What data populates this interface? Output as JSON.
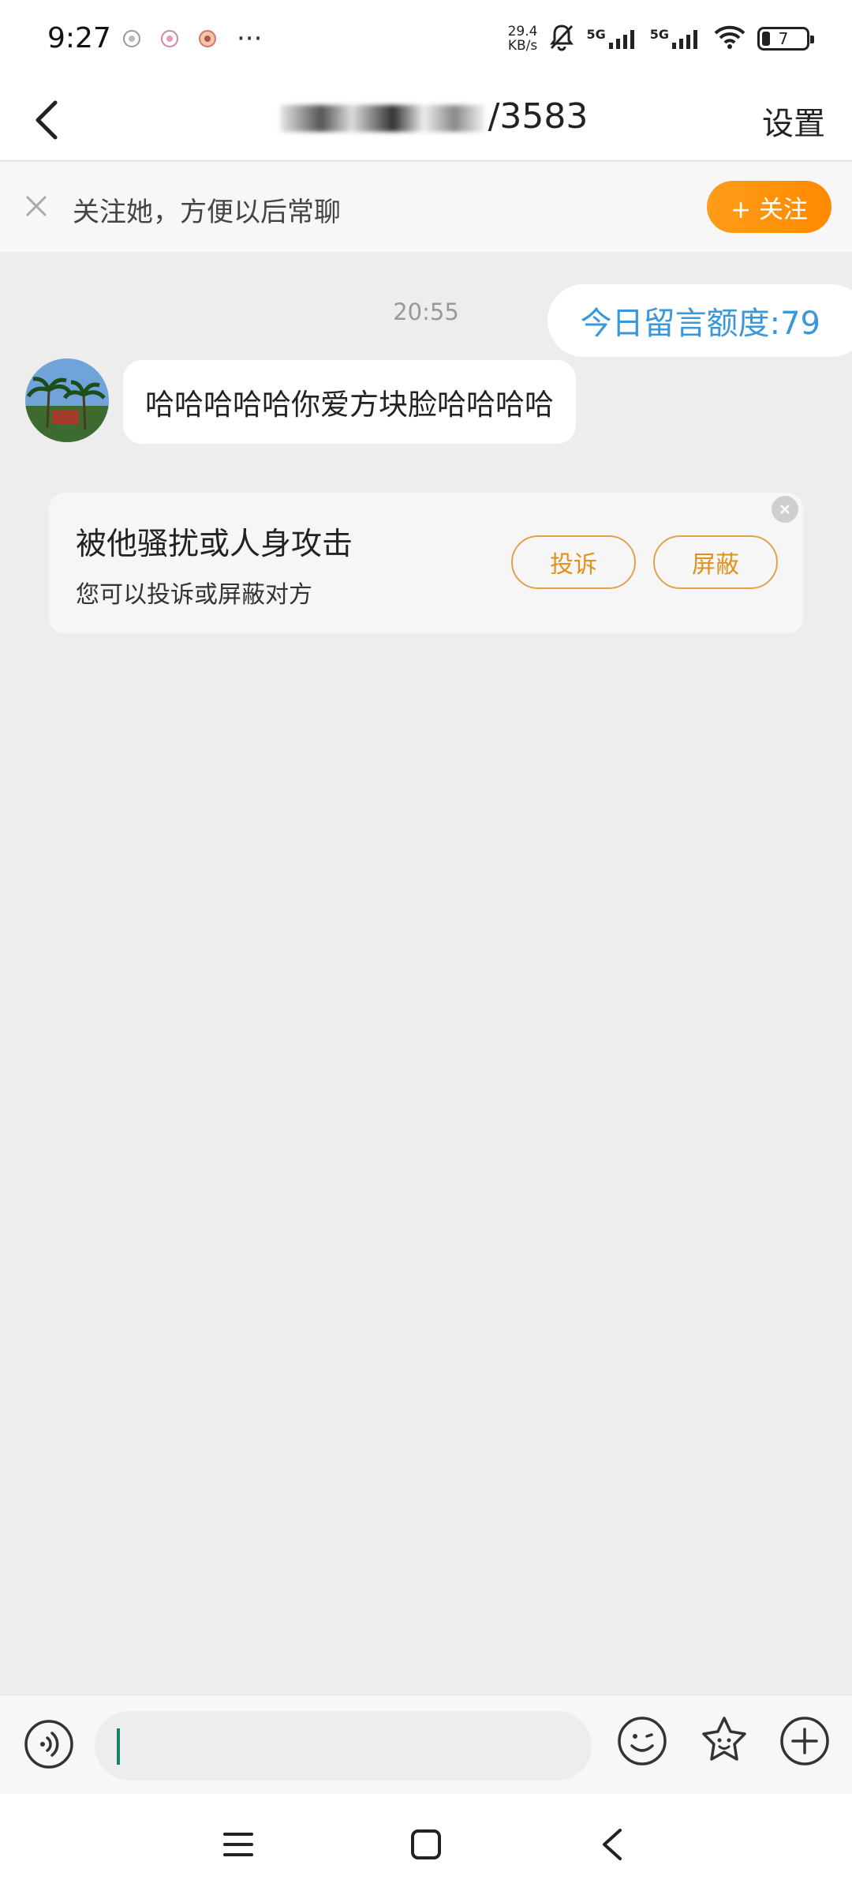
{
  "status_bar": {
    "time": "9:27",
    "more_dots": "···",
    "net_speed_value": "29.4",
    "net_speed_unit": "KB/s",
    "signal_1_label": "5G",
    "signal_2_label": "5G",
    "battery_level": "7"
  },
  "header": {
    "title_visible_part": "/3583",
    "settings_label": "设置"
  },
  "follow_banner": {
    "text": "关注她，方便以后常聊",
    "follow_button_label": "+ 关注"
  },
  "chat": {
    "timestamp": "20:55",
    "quota_text": "今日留言额度:79",
    "messages": [
      {
        "text": "哈哈哈哈哈你爱方块脸哈哈哈哈"
      }
    ]
  },
  "report_card": {
    "title": "被他骚扰或人身攻击",
    "subtitle": "您可以投诉或屏蔽对方",
    "complain_label": "投诉",
    "block_label": "屏蔽"
  },
  "input_bar": {
    "placeholder": ""
  },
  "colors": {
    "accent_orange": "#ff8f0e",
    "quota_blue": "#3a97d8",
    "chat_background": "#ededed",
    "caret_green": "#1a7f6a"
  },
  "icons": [
    "back-arrow-icon",
    "close-icon",
    "voice-icon",
    "emoji-icon",
    "sticker-icon",
    "plus-icon",
    "menu-icon",
    "home-icon",
    "nav-back-icon"
  ]
}
